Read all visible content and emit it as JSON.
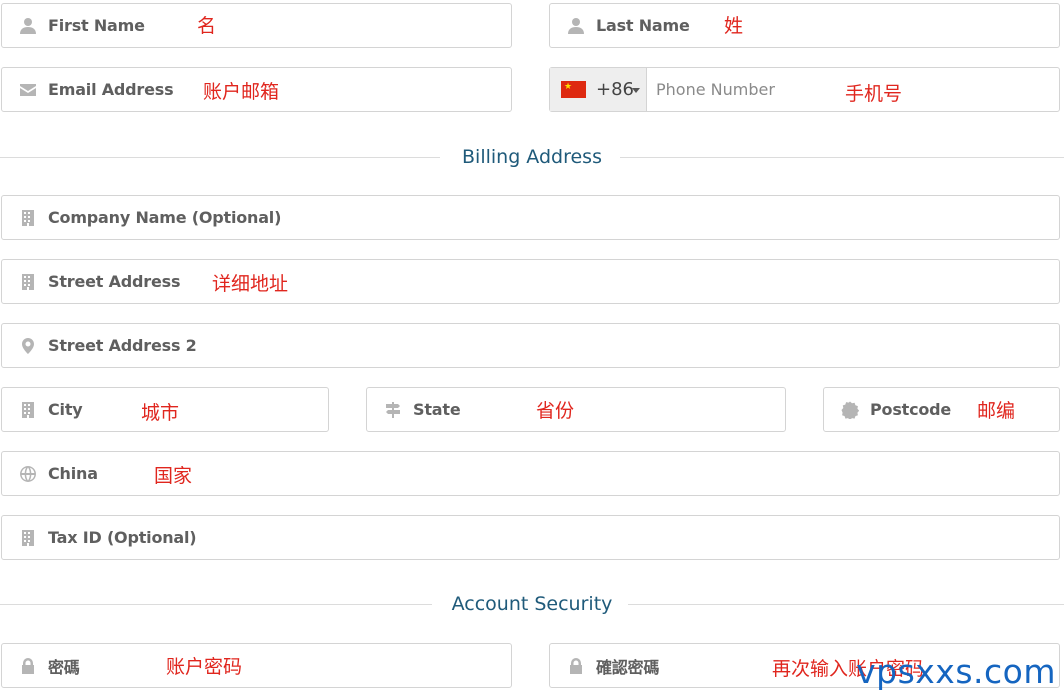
{
  "fields": {
    "first_name": "First Name",
    "last_name": "Last Name",
    "email": "Email Address",
    "phone_code": "+86",
    "phone": "Phone Number",
    "company": "Company Name (Optional)",
    "street1": "Street Address",
    "street2": "Street Address 2",
    "city": "City",
    "state": "State",
    "postcode": "Postcode",
    "country": "China",
    "tax_id": "Tax ID (Optional)",
    "password": "密碼",
    "confirm_password": "確認密碼"
  },
  "notes": {
    "first_name": "名",
    "last_name": "姓",
    "email": "账户邮箱",
    "phone": "手机号",
    "street1": "详细地址",
    "city": "城市",
    "state": "省份",
    "postcode": "邮编",
    "country": "国家",
    "password": "账户密码",
    "confirm_password": "再次输入账户密码"
  },
  "sections": {
    "billing": "Billing Address",
    "security": "Account Security"
  },
  "icons": {
    "first_name": "user-icon",
    "last_name": "user-icon",
    "email": "envelope-icon",
    "company": "building-icon",
    "street1": "building-icon",
    "street2": "map-marker-icon",
    "city": "building-icon",
    "state": "signpost-icon",
    "postcode": "certificate-icon",
    "country": "globe-icon",
    "tax_id": "building-icon",
    "password": "lock-icon",
    "confirm_password": "lock-icon"
  },
  "flag_country": "CN",
  "watermark": "vpsxxs.com"
}
